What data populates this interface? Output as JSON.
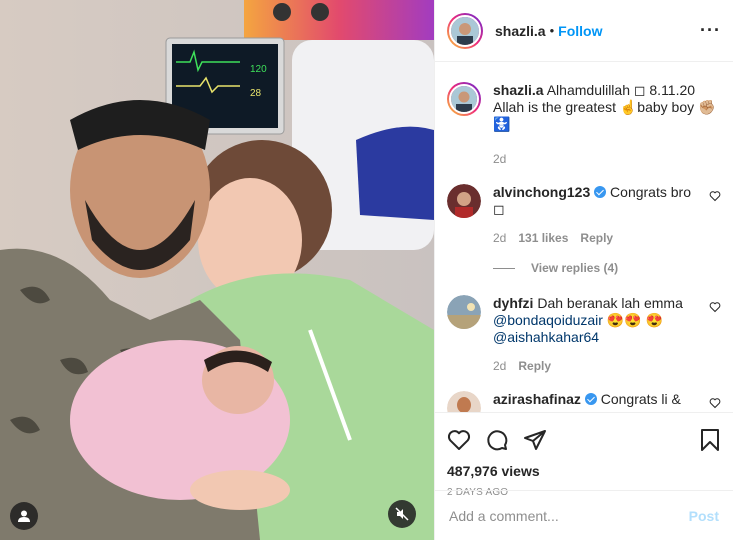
{
  "header": {
    "username": "shazli.a",
    "separator": "•",
    "follow_label": "Follow",
    "more_icon": "more-options-icon"
  },
  "caption": {
    "username": "shazli.a",
    "text": "Alhamdulillah ◻ 8.11.20 Allah is the greatest ☝️baby boy ✊🏼 🚼",
    "time": "2d"
  },
  "comments": [
    {
      "username": "alvinchong123",
      "verified": true,
      "text": "Congrats bro ◻",
      "time": "2d",
      "likes": "131 likes",
      "reply": "Reply",
      "view_replies": "View replies (4)"
    },
    {
      "username": "dyhfzi",
      "text_before": "Dah beranak lah emma",
      "mention1": "@bondaqoiduzair",
      "emoji1": "😍😍",
      "emoji2": "😍",
      "mention2": "@aishahkahar64",
      "time": "2d",
      "reply": "Reply"
    },
    {
      "username": "azirashafinaz",
      "text": "Congrats li &"
    }
  ],
  "stats": {
    "views": "487,976 views",
    "posted": "2 DAYS AGO"
  },
  "add_comment": {
    "placeholder": "Add a comment...",
    "post_label": "Post"
  },
  "colors": {
    "accent": "#0095f6",
    "post_disabled": "#b2dffc",
    "verified": "#3897f0"
  }
}
